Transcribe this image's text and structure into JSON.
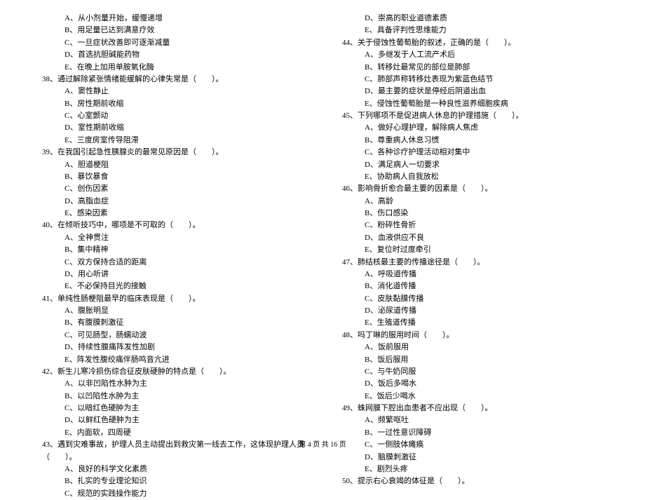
{
  "left": {
    "pre_opts": [
      "A、从小剂量开始，缓慢递增",
      "B、用足量已达到满意疗效",
      "C、一旦症状改善即可逐渐减量",
      "D、首选抗胆碱能药物",
      "E、在晚上加用单胺氧化酶"
    ],
    "items": [
      {
        "q": "38、通过解除紧张情绪能缓解的心律失常是（　　）。",
        "opts": [
          "A、窦性静止",
          "B、房性期前收缩",
          "C、心室颤动",
          "D、室性期前收缩",
          "E、三度房室传导阻滞"
        ]
      },
      {
        "q": "39、在我国引起急性胰腺炎的最常见原因是（　　）。",
        "opts": [
          "A、胆道梗阻",
          "B、暴饮暴食",
          "C、创伤因素",
          "D、高脂血症",
          "E、感染因素"
        ]
      },
      {
        "q": "40、在倾听技巧中，哪项是不可取的（　　）。",
        "opts": [
          "A、全神贯注",
          "B、集中精神",
          "C、双方保持合适的距离",
          "D、用心听讲",
          "E、不必保持目光的接触"
        ]
      },
      {
        "q": "41、单纯性肠梗阻最早的临床表现是（　　）。",
        "opts": [
          "A、腹胀明显",
          "B、有腹膜刺激征",
          "C、可见肠型，肠蠕动波",
          "D、持续性腹痛阵发性加剧",
          "E、阵发性腹绞痛伴肠鸣音亢进"
        ]
      },
      {
        "q": "42、新生儿寒冷损伤综合征皮肤硬肿的特点是（　　）。",
        "opts": [
          "A、以非凹陷性水肿为主",
          "B、以凹陷性水肿为主",
          "C、以暗红色硬肿为主",
          "D、以鲜红色硬肿为主",
          "E、内面软，四周硬"
        ]
      },
      {
        "q": "43、遇到灾难事故，护理人员主动提出到救灾第一线去工作，这体现护理人员（　　）。",
        "opts": [
          "A、良好的科学文化素质",
          "B、扎实的专业理论知识",
          "C、规范的实践操作能力"
        ]
      }
    ]
  },
  "right": {
    "pre_opts": [
      "D、崇高的职业道德素质",
      "E、具备评判性思维能力"
    ],
    "items": [
      {
        "q": "44、关于侵蚀性葡萄胎的叙述，正确的是（　　）。",
        "opts": [
          "A、多继发于人工流产术后",
          "B、转移灶最常见的部位是肺部",
          "C、肺部声称转移灶表现为紫蓝色结节",
          "D、最主要的症状是停经后阴道出血",
          "E、侵蚀性葡萄胎是一种良性滋养细胞疾病"
        ]
      },
      {
        "q": "45、下列哪项不是促进病人休息的护理措施（　　）。",
        "opts": [
          "A、做好心理护理，解除病人焦虑",
          "B、尊重病人休息习惯",
          "C、各种诊疗护理活动相对集中",
          "D、满足病人一切要求",
          "E、协助病人自我放松"
        ]
      },
      {
        "q": "46、影响骨折愈合最主要的因素是（　　）。",
        "opts": [
          "A、高龄",
          "B、伤口感染",
          "C、粉碎性骨折",
          "D、血液供应不良",
          "E、复位时过度牵引"
        ]
      },
      {
        "q": "47、肺结核最主要的传播途径是（　　）。",
        "opts": [
          "A、呼吸道传播",
          "B、消化道传播",
          "C、皮肤黏膜传播",
          "D、泌尿道传播",
          "E、生殖道传播"
        ]
      },
      {
        "q": "48、吗丁啉的服用时间（　　）。",
        "opts": [
          "A、饭前服用",
          "B、饭后服用",
          "C、与牛奶同服",
          "D、饭后多喝水",
          "E、饭后少喝水"
        ]
      },
      {
        "q": "49、蛛网膜下腔出血患者不应出现（　　）。",
        "opts": [
          "A、频繁呕吐",
          "B、一过性意识障碍",
          "C、一侧肢体瘫痪",
          "D、脑膜刺激征",
          "E、剧烈头疼"
        ]
      },
      {
        "q": "50、提示右心衰竭的体征是（　　）。",
        "opts": []
      }
    ]
  },
  "footer": "第 4 页 共 16 页"
}
